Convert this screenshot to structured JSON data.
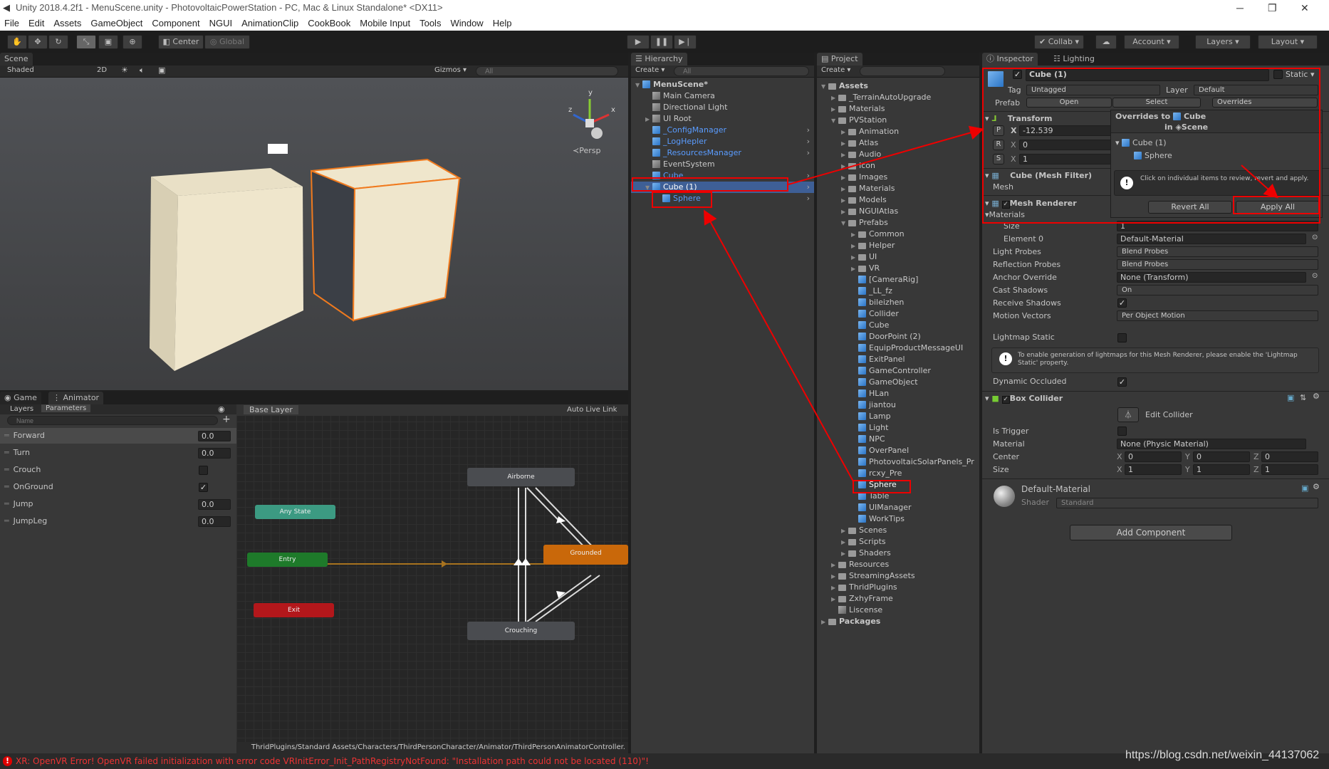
{
  "window": {
    "title": "Unity 2018.4.2f1 - MenuScene.unity - PhotovoltaicPowerStation - PC, Mac & Linux Standalone* <DX11>"
  },
  "menu": [
    "File",
    "Edit",
    "Assets",
    "GameObject",
    "Component",
    "NGUI",
    "AnimationClip",
    "CookBook",
    "Mobile Input",
    "Tools",
    "Window",
    "Help"
  ],
  "toolbar": {
    "center": "Center",
    "global": "Global",
    "collab": "Collab",
    "account": "Account",
    "layers": "Layers",
    "layout": "Layout"
  },
  "scene": {
    "tab": "Scene",
    "shading": "Shaded",
    "mode2d": "2D",
    "gizmos": "Gizmos",
    "search_placeholder": "All",
    "persp": "Persp",
    "colors": {
      "selection": "#f07a1e",
      "cube": "#efe6cc"
    }
  },
  "hierarchy": {
    "tab": "Hierarchy",
    "create": "Create",
    "search_placeholder": "All",
    "items": [
      {
        "name": "MenuScene*",
        "level": 0,
        "type": "scene",
        "bold": true,
        "expanded": true
      },
      {
        "name": "Main Camera",
        "level": 1,
        "type": "object"
      },
      {
        "name": "Directional Light",
        "level": 1,
        "type": "object"
      },
      {
        "name": "UI Root",
        "level": 1,
        "type": "object",
        "collapsed": true
      },
      {
        "name": "_ConfigManager",
        "level": 1,
        "type": "prefab",
        "more": true
      },
      {
        "name": "_LogHepler",
        "level": 1,
        "type": "prefab",
        "more": true
      },
      {
        "name": "_ResourcesManager",
        "level": 1,
        "type": "prefab",
        "more": true
      },
      {
        "name": "EventSystem",
        "level": 1,
        "type": "object"
      },
      {
        "name": "Cube",
        "level": 1,
        "type": "prefab",
        "more": true
      },
      {
        "name": "Cube (1)",
        "level": 1,
        "type": "prefab",
        "more": true,
        "selected": true,
        "expanded": true
      },
      {
        "name": "Sphere",
        "level": 2,
        "type": "added",
        "more": true
      }
    ]
  },
  "project": {
    "tab": "Project",
    "create": "Create",
    "items": [
      {
        "name": "Assets",
        "level": 0,
        "type": "folder",
        "bold": true,
        "expanded": true
      },
      {
        "name": "_TerrainAutoUpgrade",
        "level": 1,
        "type": "folder",
        "collapsed": true
      },
      {
        "name": "Materials",
        "level": 1,
        "type": "folder",
        "collapsed": true
      },
      {
        "name": "PVStation",
        "level": 1,
        "type": "folder",
        "expanded": true
      },
      {
        "name": "Animation",
        "level": 2,
        "type": "folder",
        "collapsed": true
      },
      {
        "name": "Atlas",
        "level": 2,
        "type": "folder",
        "collapsed": true
      },
      {
        "name": "Audio",
        "level": 2,
        "type": "folder",
        "collapsed": true
      },
      {
        "name": "Icon",
        "level": 2,
        "type": "folder",
        "collapsed": true
      },
      {
        "name": "Images",
        "level": 2,
        "type": "folder",
        "collapsed": true
      },
      {
        "name": "Materials",
        "level": 2,
        "type": "folder",
        "collapsed": true
      },
      {
        "name": "Models",
        "level": 2,
        "type": "folder",
        "collapsed": true
      },
      {
        "name": "NGUIAtlas",
        "level": 2,
        "type": "folder",
        "collapsed": true
      },
      {
        "name": "Prefabs",
        "level": 2,
        "type": "folder",
        "expanded": true
      },
      {
        "name": "Common",
        "level": 3,
        "type": "folder",
        "collapsed": true
      },
      {
        "name": "Helper",
        "level": 3,
        "type": "folder",
        "collapsed": true
      },
      {
        "name": "UI",
        "level": 3,
        "type": "folder",
        "collapsed": true
      },
      {
        "name": "VR",
        "level": 3,
        "type": "folder",
        "collapsed": true
      },
      {
        "name": "[CameraRig]",
        "level": 3,
        "type": "prefab"
      },
      {
        "name": "_LL_fz",
        "level": 3,
        "type": "prefab"
      },
      {
        "name": "bileizhen",
        "level": 3,
        "type": "prefab"
      },
      {
        "name": "Collider",
        "level": 3,
        "type": "prefab"
      },
      {
        "name": "Cube",
        "level": 3,
        "type": "prefab"
      },
      {
        "name": "DoorPoint (2)",
        "level": 3,
        "type": "prefab"
      },
      {
        "name": "EquipProductMessageUI",
        "level": 3,
        "type": "prefab"
      },
      {
        "name": "ExitPanel",
        "level": 3,
        "type": "prefab"
      },
      {
        "name": "GameController",
        "level": 3,
        "type": "prefab"
      },
      {
        "name": "GameObject",
        "level": 3,
        "type": "prefab"
      },
      {
        "name": "HLan",
        "level": 3,
        "type": "prefab"
      },
      {
        "name": "jiantou",
        "level": 3,
        "type": "prefab"
      },
      {
        "name": "Lamp",
        "level": 3,
        "type": "prefab"
      },
      {
        "name": "Light",
        "level": 3,
        "type": "prefab"
      },
      {
        "name": "NPC",
        "level": 3,
        "type": "prefab"
      },
      {
        "name": "OverPanel",
        "level": 3,
        "type": "prefab"
      },
      {
        "name": "PhotovoltaicSolarPanels_Pr",
        "level": 3,
        "type": "prefab"
      },
      {
        "name": "rcxy_Pre",
        "level": 3,
        "type": "prefab"
      },
      {
        "name": "Sphere",
        "level": 3,
        "type": "prefab",
        "highlighted": true
      },
      {
        "name": "Table",
        "level": 3,
        "type": "prefab"
      },
      {
        "name": "UIManager",
        "level": 3,
        "type": "prefab"
      },
      {
        "name": "WorkTips",
        "level": 3,
        "type": "prefab"
      },
      {
        "name": "Scenes",
        "level": 2,
        "type": "folder",
        "collapsed": true
      },
      {
        "name": "Scripts",
        "level": 2,
        "type": "folder",
        "collapsed": true
      },
      {
        "name": "Shaders",
        "level": 2,
        "type": "folder",
        "collapsed": true
      },
      {
        "name": "Resources",
        "level": 1,
        "type": "folder",
        "collapsed": true
      },
      {
        "name": "StreamingAssets",
        "level": 1,
        "type": "folder",
        "collapsed": true
      },
      {
        "name": "ThridPlugins",
        "level": 1,
        "type": "folder",
        "collapsed": true
      },
      {
        "name": "ZxhyFrame",
        "level": 1,
        "type": "folder",
        "collapsed": true
      },
      {
        "name": "Lisсense",
        "level": 1,
        "type": "file"
      },
      {
        "name": "Packages",
        "level": 0,
        "type": "folder",
        "bold": true,
        "collapsed": true
      }
    ]
  },
  "inspector": {
    "tab": "Inspector",
    "lighting_tab": "Lighting",
    "object_name": "Cube (1)",
    "active": true,
    "static_label": "Static",
    "tag_label": "Tag",
    "tag": "Untagged",
    "layer_label": "Layer",
    "layer": "Default",
    "prefab_label": "Prefab",
    "open": "Open",
    "select": "Select",
    "overrides": "Overrides",
    "transform": {
      "title": "Transform",
      "p": "P",
      "r": "R",
      "s": "S",
      "px": "-12.539",
      "rx": "0",
      "sx": "1",
      "x": "X"
    },
    "mesh_filter": {
      "title": "Cube (Mesh Filter)",
      "mesh_label": "Mesh"
    },
    "mesh_renderer": {
      "title": "Mesh Renderer",
      "materials": "Materials",
      "rows": [
        {
          "label": "Size",
          "value": "1",
          "kind": "field"
        },
        {
          "label": "Element 0",
          "value": "Default-Material",
          "kind": "object"
        },
        {
          "label": "Light Probes",
          "value": "Blend Probes",
          "kind": "drop"
        },
        {
          "label": "Reflection Probes",
          "value": "Blend Probes",
          "kind": "drop"
        },
        {
          "label": "Anchor Override",
          "value": "None (Transform)",
          "kind": "object"
        },
        {
          "label": "Cast Shadows",
          "value": "On",
          "kind": "drop"
        },
        {
          "label": "Receive Shadows",
          "value": "✓",
          "kind": "check"
        },
        {
          "label": "Motion Vectors",
          "value": "Per Object Motion",
          "kind": "drop"
        }
      ],
      "lightmap_static": "Lightmap Static",
      "lightmap_help": "To enable generation of lightmaps for this Mesh Renderer, please enable the 'Lightmap Static' property.",
      "dynamic_occluded": "Dynamic Occluded"
    },
    "box_collider": {
      "title": "Box Collider",
      "edit": "Edit Collider",
      "is_trigger": "Is Trigger",
      "material_label": "Material",
      "material": "None (Physic Material)",
      "center_label": "Center",
      "size_label": "Size",
      "center": {
        "x": "0",
        "y": "0",
        "z": "0"
      },
      "size": {
        "x": "1",
        "y": "1",
        "z": "1"
      }
    },
    "material": {
      "name": "Default-Material",
      "shader_label": "Shader",
      "shader": "Standard"
    },
    "add_component": "Add Component",
    "overrides_popup": {
      "title1": "Overrides to",
      "target": "Cube",
      "title2": "in",
      "scene": "Scene",
      "tree": [
        "Cube (1)",
        "Sphere"
      ],
      "help": "Click on individual items to review, revert and apply.",
      "revert": "Revert All",
      "apply": "Apply All"
    }
  },
  "animator": {
    "game_tab": "Game",
    "animator_tab": "Animator",
    "layers": "Layers",
    "parameters": "Parameters",
    "search_placeholder": "Name",
    "base_layer": "Base Layer",
    "auto_live": "Auto Live Link",
    "params": [
      {
        "name": "Forward",
        "value": "0.0"
      },
      {
        "name": "Turn",
        "value": "0.0"
      },
      {
        "name": "Crouch",
        "bool": false
      },
      {
        "name": "OnGround",
        "bool": true
      },
      {
        "name": "Jump",
        "value": "0.0"
      },
      {
        "name": "JumpLeg",
        "value": "0.0"
      }
    ],
    "states": {
      "airborne": "Airborne",
      "any": "Any State",
      "entry": "Entry",
      "exit": "Exit",
      "grounded": "Grounded",
      "crouching": "Crouching"
    },
    "path": "ThridPlugins/Standard Assets/Characters/ThirdPersonCharacter/Animator/ThirdPersonAnimatorController."
  },
  "status": {
    "error": "XR: OpenVR Error! OpenVR failed initialization with error code VRInitError_Init_PathRegistryNotFound: \"Installation path could not be located (110)\"!"
  },
  "watermark": "https://blog.csdn.net/weixin_44137062"
}
